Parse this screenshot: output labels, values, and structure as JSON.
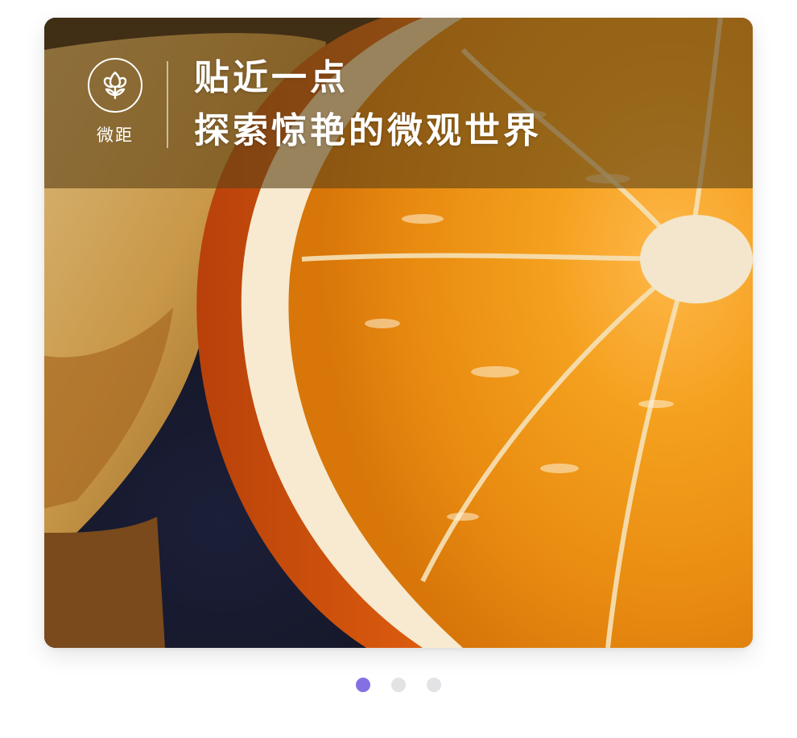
{
  "carousel": {
    "slide": {
      "mode_icon": "flower-macro-icon",
      "mode_label": "微距",
      "headline_line1": "贴近一点",
      "headline_line2": "探索惊艳的微观世界",
      "image": "macro-orange-slice-photo"
    },
    "dots": {
      "count": 3,
      "active_index": 0,
      "active_color": "#8470e3",
      "inactive_color": "#e3e3e6"
    }
  }
}
